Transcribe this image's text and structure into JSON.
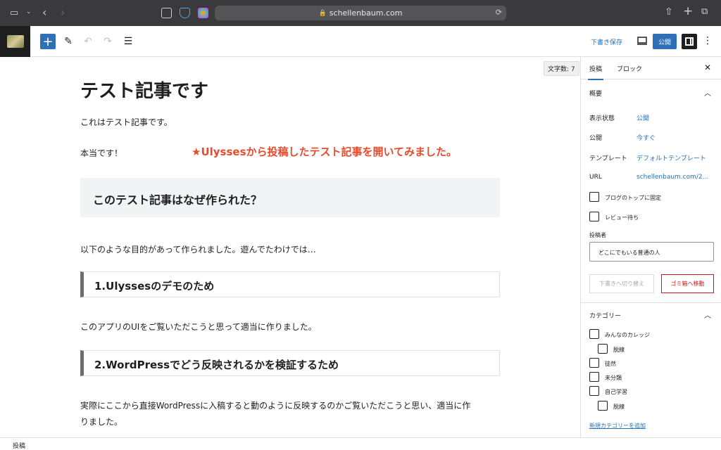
{
  "browser": {
    "url": "schellenbaum.com"
  },
  "toolbar": {
    "save_draft": "下書き保存",
    "publish": "公開"
  },
  "editor": {
    "word_count": "文字数: 7",
    "title": "テスト記事です",
    "para1": "これはテスト記事です。",
    "para2": "本当です！",
    "note": "★Ulyssesから投稿したテスト記事を開いてみました。",
    "heading2": "このテスト記事はなぜ作られた？",
    "para3": "以下のような目的があって作られました。遊んでたわけでは…",
    "heading3a": "1.Ulyssesのデモのため",
    "para4": "このアプリのUIをご覧いただこうと思って適当に作りました。",
    "heading3b": "2.WordPressでどう反映されるかを検証するため",
    "para5_line1": "実際にここから直接WordPressに入稿すると動のように反映するのかご覧いただこうと思い、適当に作",
    "para5_line2": "りました。"
  },
  "sidebar": {
    "tab_post": "投稿",
    "tab_block": "ブロック",
    "summary_title": "概要",
    "visibility_label": "表示状態",
    "visibility_value": "公開",
    "publish_label": "公開",
    "publish_value": "今すぐ",
    "template_label": "テンプレート",
    "template_value": "デフォルトテンプレート",
    "url_label": "URL",
    "url_value": "schellenbaum.com/2...",
    "sticky_label": "ブログのトップに固定",
    "pending_label": "レビュー待ち",
    "author_label": "投稿者",
    "author_value": "どこにでもいる普通の人",
    "switch_draft": "下書きへ切り替え",
    "move_trash": "ゴミ箱へ移動",
    "categories_title": "カテゴリー",
    "categories": [
      {
        "name": "みんなのカレッジ",
        "child": false
      },
      {
        "name": "脱線",
        "child": true
      },
      {
        "name": "徒然",
        "child": false
      },
      {
        "name": "未分類",
        "child": false
      },
      {
        "name": "自己学習",
        "child": false
      },
      {
        "name": "脱線",
        "child": true
      }
    ],
    "add_category": "新規カテゴリーを追加"
  },
  "footer": {
    "breadcrumb": "投稿"
  },
  "colors": {
    "accent": "#2f6fb5",
    "note_red": "#e64b2c",
    "trash_red": "#cc1818",
    "link": "#2271b1"
  }
}
